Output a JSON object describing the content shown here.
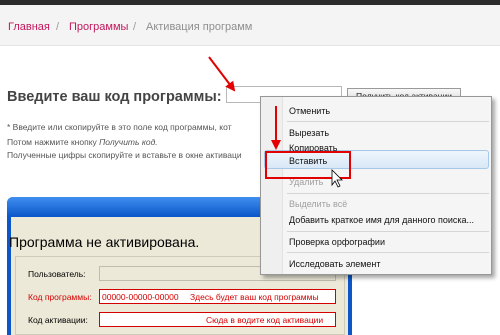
{
  "breadcrumb": {
    "home": "Главная",
    "programs": "Программы",
    "current": "Активация программ",
    "separator": "/"
  },
  "activation": {
    "heading": "Введите ваш код программы:",
    "get_code_button": "Получить код активации",
    "instructions": [
      "* Введите или скопируйте в это поле код программы, кот",
      "Потом нажмите кнопку ",
      "Полученные цифры скопируйте и вставьте в окне активаци"
    ],
    "instruction_emphasis": "Получить код."
  },
  "context_menu": {
    "items": {
      "undo": "Отменить",
      "cut": "Вырезать",
      "copy": "Копировать",
      "paste": "Вставить",
      "delete": "Удалить",
      "select_all": "Выделить всё",
      "add_keyword": "Добавить краткое имя для данного поиска...",
      "spellcheck": "Проверка орфографии",
      "inspect": "Исследовать элемент"
    },
    "highlighted": "paste"
  },
  "program_window": {
    "title": "Программа не активирована.",
    "fields": {
      "user_label": "Пользователь:",
      "code_label": "Код программы:",
      "code_value": "00000-00000-00000",
      "code_hint": "Здесь будет ваш код программы",
      "activation_label": "Код активации:",
      "activation_hint": "Сюда в водите код активации"
    }
  },
  "colors": {
    "link": "#c2185b",
    "annotation_red": "#e30000",
    "window_blue": "#0b56c8",
    "menu_highlight": "#d9e8f7"
  }
}
